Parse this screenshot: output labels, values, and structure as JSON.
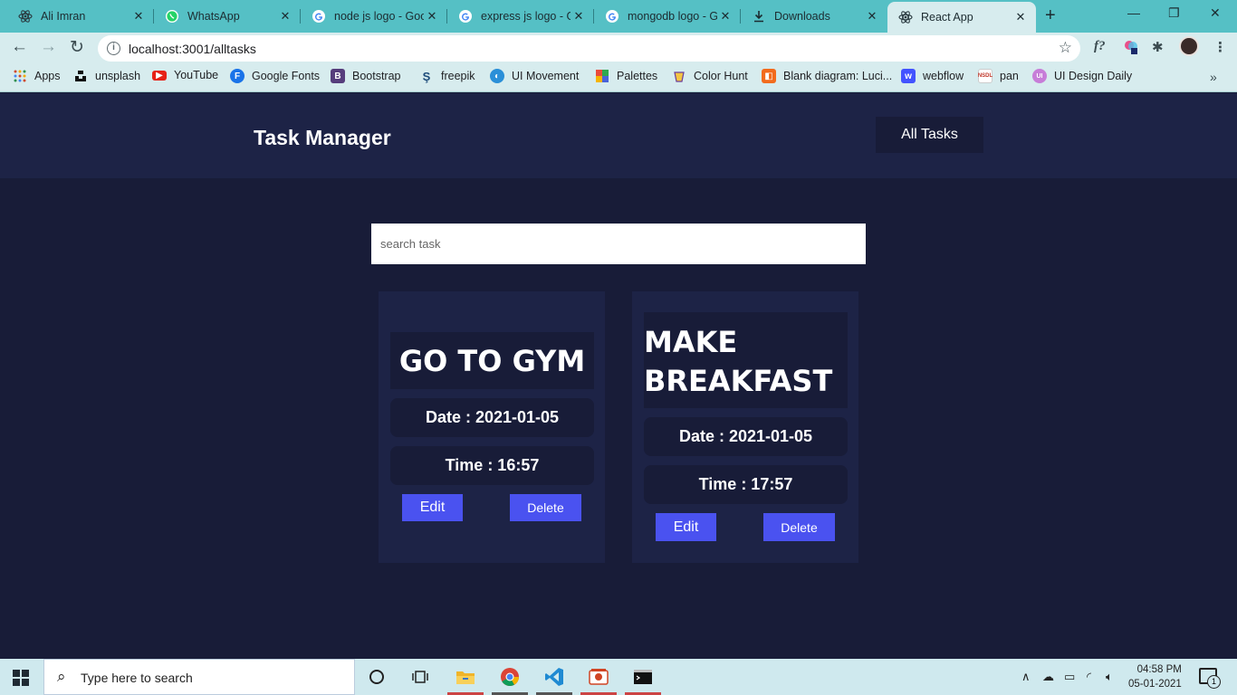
{
  "browser": {
    "tabs": [
      {
        "label": "Ali Imran",
        "icon": "react-icon"
      },
      {
        "label": "WhatsApp",
        "icon": "whatsapp-icon"
      },
      {
        "label": "node js logo - Goo",
        "icon": "google-icon"
      },
      {
        "label": "express js logo - G",
        "icon": "google-icon"
      },
      {
        "label": "mongodb logo - G",
        "icon": "google-icon"
      },
      {
        "label": "Downloads",
        "icon": "download-icon"
      },
      {
        "label": "React App",
        "icon": "react-icon",
        "active": true
      }
    ],
    "url": "localhost:3001/alltasks",
    "bookmarks": [
      "Apps",
      "unsplash",
      "YouTube",
      "Google Fonts",
      "Bootstrap",
      "freepik",
      "UI Movement",
      "Palettes",
      "Color Hunt",
      "Blank diagram: Luci...",
      "webflow",
      "pan",
      "UI Design Daily"
    ],
    "bookmark_more": "»",
    "ext_label": "f?",
    "colors": {
      "tabstrip": "#55c0c5",
      "toolbar": "#d7ecee"
    }
  },
  "app": {
    "brand": "Task Manager",
    "nav_button": "All Tasks",
    "search_placeholder": "search task",
    "tasks": [
      {
        "title": "GO TO GYM",
        "date": "Date : 2021-01-05",
        "time": "Time : 16:57",
        "edit": "Edit",
        "delete": "Delete"
      },
      {
        "title": "MAKE BREAKFAST",
        "date": "Date : 2021-01-05",
        "time": "Time : 17:57",
        "edit": "Edit",
        "delete": "Delete"
      }
    ],
    "colors": {
      "background": "#181c38",
      "panel": "#1d2346",
      "accent": "#4a52f0"
    }
  },
  "taskbar": {
    "search_text": "Type here to search",
    "time": "04:58 PM",
    "date": "05-01-2021",
    "notification_count": "1"
  }
}
